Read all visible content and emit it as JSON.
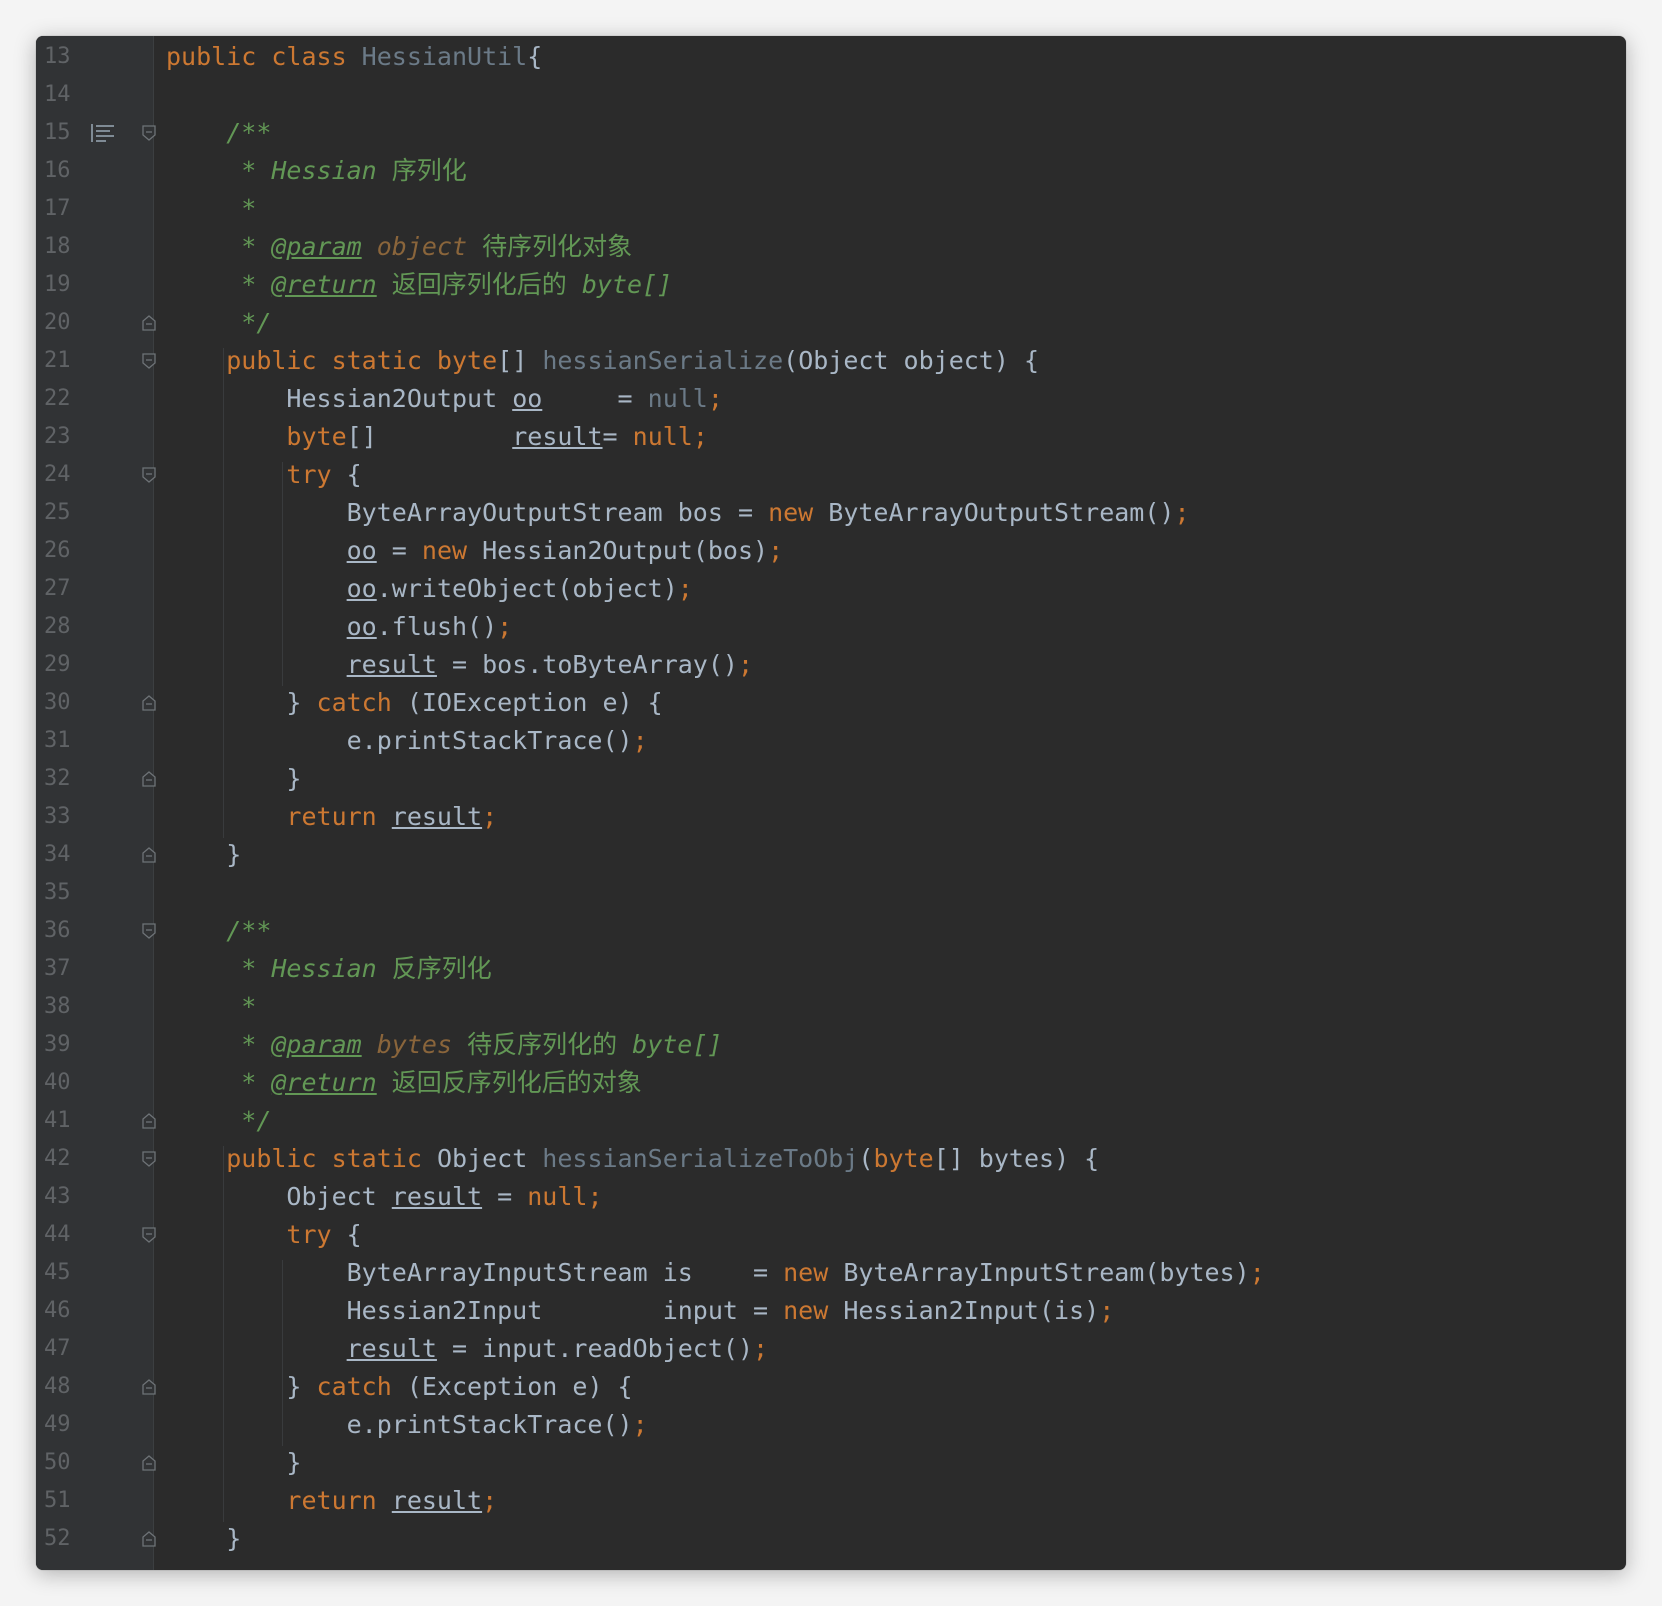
{
  "editor": {
    "lines": [
      {
        "n": "13",
        "tokens": [
          [
            "kw",
            "public class "
          ],
          [
            "fn",
            "HessianUtil"
          ],
          [
            "",
            "{"
          ]
        ]
      },
      {
        "n": "14",
        "tokens": []
      },
      {
        "n": "15",
        "tokens": [
          [
            "",
            "    "
          ],
          [
            "cm",
            "/**"
          ]
        ]
      },
      {
        "n": "16",
        "tokens": [
          [
            "",
            "     "
          ],
          [
            "cm",
            "* Hessian "
          ],
          [
            "cjk",
            "序列化"
          ]
        ]
      },
      {
        "n": "17",
        "tokens": [
          [
            "",
            "     "
          ],
          [
            "cm",
            "*"
          ]
        ]
      },
      {
        "n": "18",
        "tokens": [
          [
            "",
            "     "
          ],
          [
            "cm",
            "* "
          ],
          [
            "tag",
            "@param"
          ],
          [
            "cm",
            " "
          ],
          [
            "pn",
            "object"
          ],
          [
            "cm",
            " "
          ],
          [
            "cjk",
            "待序列化对象"
          ]
        ]
      },
      {
        "n": "19",
        "tokens": [
          [
            "",
            "     "
          ],
          [
            "cm",
            "* "
          ],
          [
            "tag",
            "@return"
          ],
          [
            "cm",
            " "
          ],
          [
            "cjk",
            "返回序列化后的"
          ],
          [
            "cm",
            " byte[]"
          ]
        ]
      },
      {
        "n": "20",
        "tokens": [
          [
            "",
            "     "
          ],
          [
            "cm",
            "*/"
          ]
        ]
      },
      {
        "n": "21",
        "tokens": [
          [
            "",
            "    "
          ],
          [
            "kw",
            "public static byte"
          ],
          [
            "",
            "[] "
          ],
          [
            "fn",
            "hessianSerialize"
          ],
          [
            "",
            "(Object object) {"
          ]
        ]
      },
      {
        "n": "22",
        "tokens": [
          [
            "",
            "        Hessian2Output "
          ],
          [
            "ul",
            "oo"
          ],
          [
            "",
            "     = "
          ],
          [
            "fn",
            "null"
          ],
          [
            "kw",
            ";"
          ]
        ]
      },
      {
        "n": "23",
        "tokens": [
          [
            "",
            "        "
          ],
          [
            "kw",
            "byte"
          ],
          [
            "",
            "[]         "
          ],
          [
            "ul",
            "result"
          ],
          [
            "",
            ""
          ],
          [
            "",
            "= "
          ],
          [
            "kw",
            "null;"
          ]
        ]
      },
      {
        "n": "24",
        "tokens": [
          [
            "",
            "        "
          ],
          [
            "kw",
            "try"
          ],
          [
            "",
            " {"
          ]
        ]
      },
      {
        "n": "25",
        "tokens": [
          [
            "",
            "            ByteArrayOutputStream bos = "
          ],
          [
            "kw",
            "new"
          ],
          [
            "",
            " ByteArrayOutputStream()"
          ],
          [
            "kw",
            ";"
          ]
        ]
      },
      {
        "n": "26",
        "tokens": [
          [
            "",
            "            "
          ],
          [
            "ul",
            "oo"
          ],
          [
            "",
            " = "
          ],
          [
            "kw",
            "new"
          ],
          [
            "",
            " Hessian2Output(bos)"
          ],
          [
            "kw",
            ";"
          ]
        ]
      },
      {
        "n": "27",
        "tokens": [
          [
            "",
            "            "
          ],
          [
            "ul",
            "oo"
          ],
          [
            "",
            ".writeObject(object)"
          ],
          [
            "kw",
            ";"
          ]
        ]
      },
      {
        "n": "28",
        "tokens": [
          [
            "",
            "            "
          ],
          [
            "ul",
            "oo"
          ],
          [
            "",
            ".flush()"
          ],
          [
            "kw",
            ";"
          ]
        ]
      },
      {
        "n": "29",
        "tokens": [
          [
            "",
            "            "
          ],
          [
            "ul",
            "result"
          ],
          [
            "",
            " = bos.toByteArray()"
          ],
          [
            "kw",
            ";"
          ]
        ]
      },
      {
        "n": "30",
        "tokens": [
          [
            "",
            "        } "
          ],
          [
            "kw",
            "catch"
          ],
          [
            "",
            " (IOException e) {"
          ]
        ]
      },
      {
        "n": "31",
        "tokens": [
          [
            "",
            "            e.printStackTrace()"
          ],
          [
            "kw",
            ";"
          ]
        ]
      },
      {
        "n": "32",
        "tokens": [
          [
            "",
            "        }"
          ]
        ]
      },
      {
        "n": "33",
        "tokens": [
          [
            "",
            "        "
          ],
          [
            "kw",
            "return "
          ],
          [
            "ul",
            "result"
          ],
          [
            "kw",
            ";"
          ]
        ]
      },
      {
        "n": "34",
        "tokens": [
          [
            "",
            "    }"
          ]
        ]
      },
      {
        "n": "35",
        "tokens": []
      },
      {
        "n": "36",
        "tokens": [
          [
            "",
            "    "
          ],
          [
            "cm",
            "/**"
          ]
        ]
      },
      {
        "n": "37",
        "tokens": [
          [
            "",
            "     "
          ],
          [
            "cm",
            "* Hessian "
          ],
          [
            "cjk",
            "反序列化"
          ]
        ]
      },
      {
        "n": "38",
        "tokens": [
          [
            "",
            "     "
          ],
          [
            "cm",
            "*"
          ]
        ]
      },
      {
        "n": "39",
        "tokens": [
          [
            "",
            "     "
          ],
          [
            "cm",
            "* "
          ],
          [
            "tag",
            "@param"
          ],
          [
            "cm",
            " "
          ],
          [
            "pn",
            "bytes"
          ],
          [
            "cm",
            " "
          ],
          [
            "cjk",
            "待反序列化的"
          ],
          [
            "cm",
            " byte[]"
          ]
        ]
      },
      {
        "n": "40",
        "tokens": [
          [
            "",
            "     "
          ],
          [
            "cm",
            "* "
          ],
          [
            "tag",
            "@return"
          ],
          [
            "cm",
            " "
          ],
          [
            "cjk",
            "返回反序列化后的对象"
          ]
        ]
      },
      {
        "n": "41",
        "tokens": [
          [
            "",
            "     "
          ],
          [
            "cm",
            "*/"
          ]
        ]
      },
      {
        "n": "42",
        "tokens": [
          [
            "",
            "    "
          ],
          [
            "kw",
            "public static "
          ],
          [
            "",
            "Object "
          ],
          [
            "fn",
            "hessianSerializeToObj"
          ],
          [
            "",
            "("
          ],
          [
            "kw",
            "byte"
          ],
          [
            "",
            "[] bytes) {"
          ]
        ]
      },
      {
        "n": "43",
        "tokens": [
          [
            "",
            "        Object "
          ],
          [
            "ul",
            "result"
          ],
          [
            "",
            " = "
          ],
          [
            "kw",
            "null;"
          ]
        ]
      },
      {
        "n": "44",
        "tokens": [
          [
            "",
            "        "
          ],
          [
            "kw",
            "try"
          ],
          [
            "",
            " {"
          ]
        ]
      },
      {
        "n": "45",
        "tokens": [
          [
            "",
            "            ByteArrayInputStream is    = "
          ],
          [
            "kw",
            "new"
          ],
          [
            "",
            " ByteArrayInputStream(bytes)"
          ],
          [
            "kw",
            ";"
          ]
        ]
      },
      {
        "n": "46",
        "tokens": [
          [
            "",
            "            Hessian2Input        input = "
          ],
          [
            "kw",
            "new"
          ],
          [
            "",
            " Hessian2Input(is)"
          ],
          [
            "kw",
            ";"
          ]
        ]
      },
      {
        "n": "47",
        "tokens": [
          [
            "",
            "            "
          ],
          [
            "ul",
            "result"
          ],
          [
            "",
            " = input.readObject()"
          ],
          [
            "kw",
            ";"
          ]
        ]
      },
      {
        "n": "48",
        "tokens": [
          [
            "",
            "        } "
          ],
          [
            "kw",
            "catch"
          ],
          [
            "",
            " (Exception e) {"
          ]
        ]
      },
      {
        "n": "49",
        "tokens": [
          [
            "",
            "            e.printStackTrace()"
          ],
          [
            "kw",
            ";"
          ]
        ]
      },
      {
        "n": "50",
        "tokens": [
          [
            "",
            "        }"
          ]
        ]
      },
      {
        "n": "51",
        "tokens": [
          [
            "",
            "        "
          ],
          [
            "kw",
            "return "
          ],
          [
            "ul",
            "result"
          ],
          [
            "kw",
            ";"
          ]
        ]
      },
      {
        "n": "52",
        "tokens": [
          [
            "",
            "    }"
          ]
        ]
      }
    ],
    "fold_open_lines": [
      "15",
      "21",
      "24",
      "36",
      "42",
      "44"
    ],
    "fold_close_lines": [
      "20",
      "30",
      "32",
      "34",
      "41",
      "48",
      "50",
      "52"
    ],
    "doc_icon_line": "15",
    "colors": {
      "background": "#2b2b2b",
      "gutter": "#313335",
      "line_number": "#606366",
      "keyword": "#cc7832",
      "default": "#a9b7c6",
      "method_decl": "#6b7a87",
      "comment": "#629755",
      "param_name": "#8a653b"
    }
  }
}
